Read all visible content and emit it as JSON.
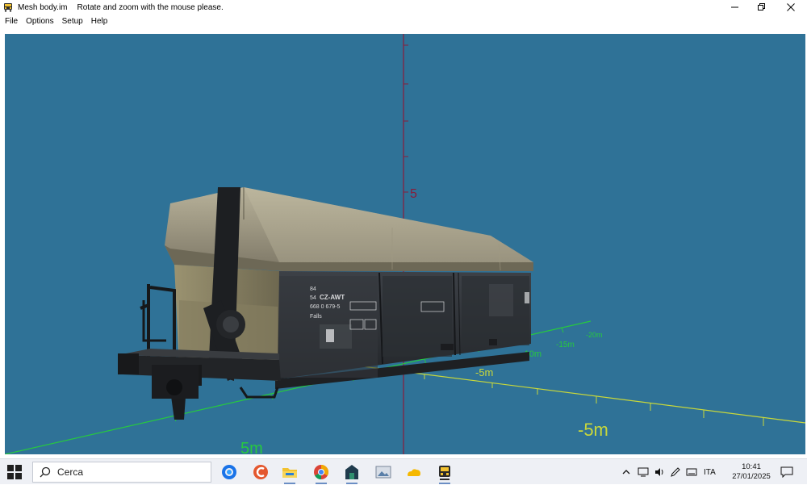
{
  "window": {
    "title": "Mesh body.im",
    "subtitle": "Rotate and zoom with the mouse please.",
    "controls": [
      "minimize",
      "restore",
      "close"
    ]
  },
  "menu": {
    "items": [
      {
        "label": "File"
      },
      {
        "label": "Options"
      },
      {
        "label": "Setup"
      },
      {
        "label": "Help"
      }
    ]
  },
  "viewport": {
    "background": "#2f7297",
    "axis_labels": {
      "vertical_5": "5",
      "x_20m": "-20m",
      "x_15m": "-15m",
      "x_10m": "-10m",
      "x_5m_small": "-5m",
      "x_5m_large": "-5m",
      "bottom_5m": "5m",
      "left_frag": "5m"
    },
    "wagon_markings": {
      "line1": "84",
      "line2": "54",
      "operator": "CZ-AWT",
      "number": "668 0 679-5",
      "class": "Falls"
    }
  },
  "taskbar": {
    "search_placeholder": "Cerca",
    "apps": [
      "task-view",
      "edge",
      "ccleaner",
      "file-explorer",
      "chrome",
      "network-app",
      "photos",
      "folder",
      "train-app"
    ],
    "tray": {
      "language": "ITA",
      "time": "10:41",
      "date": "27/01/2025"
    }
  },
  "colors": {
    "axis_red": "#8a1c3a",
    "axis_green": "#27c93f",
    "axis_yellow": "#c9d83a",
    "sky": "#2f7297"
  }
}
